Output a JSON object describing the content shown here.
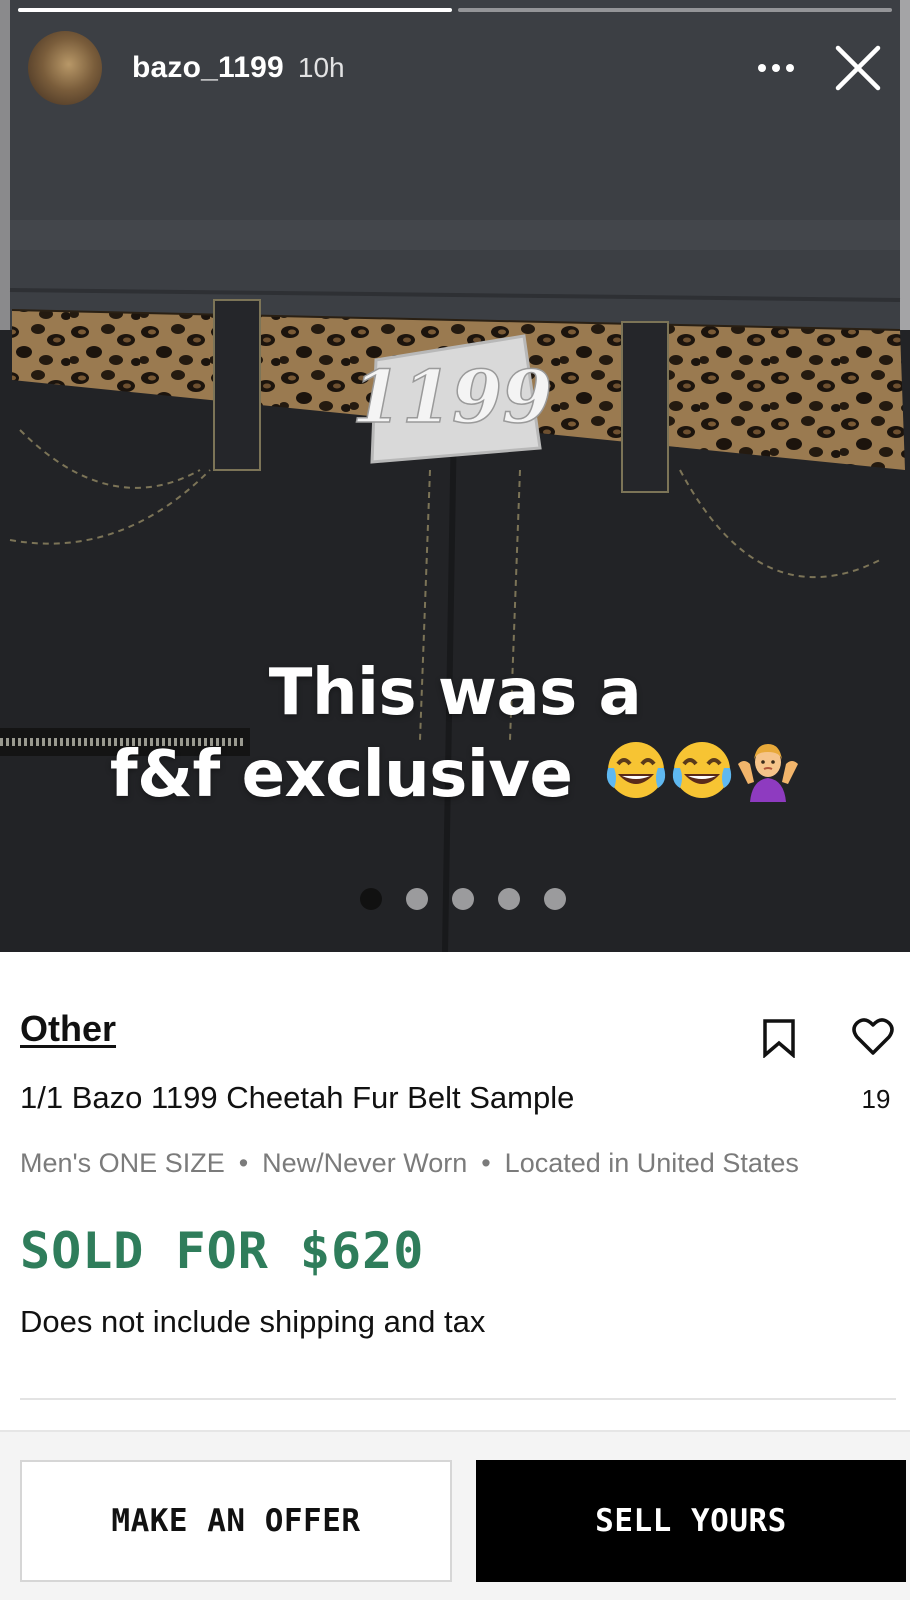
{
  "story": {
    "username": "bazo_1199",
    "time_ago": "10h",
    "progress_segments": [
      1.0,
      0.0
    ],
    "caption_line1": "This was a",
    "caption_line2": "f&f exclusive",
    "caption_emojis": [
      "face-with-tears-of-joy-emoji",
      "face-with-tears-of-joy-emoji",
      "woman-shrugging-emoji"
    ],
    "buckle_text": "1199",
    "carousel_dots": 5,
    "carousel_active_index": 0
  },
  "listing": {
    "category": "Other",
    "title": "1/1 Bazo 1199 Cheetah Fur Belt Sample",
    "like_count": "19",
    "meta": [
      "Men's ONE SIZE",
      "New/Never Worn",
      "Located in United States"
    ],
    "meta_separator": "•",
    "sold_label": "SOLD FOR $620",
    "sold_color": "#2f7d5b",
    "shipping_note": "Does not include shipping and tax"
  },
  "actions": {
    "offer_label": "MAKE AN OFFER",
    "sell_label": "SELL YOURS"
  },
  "icons": {
    "more": "more-horizontal-icon",
    "close": "close-icon",
    "save": "bookmark-icon",
    "like": "heart-icon"
  }
}
